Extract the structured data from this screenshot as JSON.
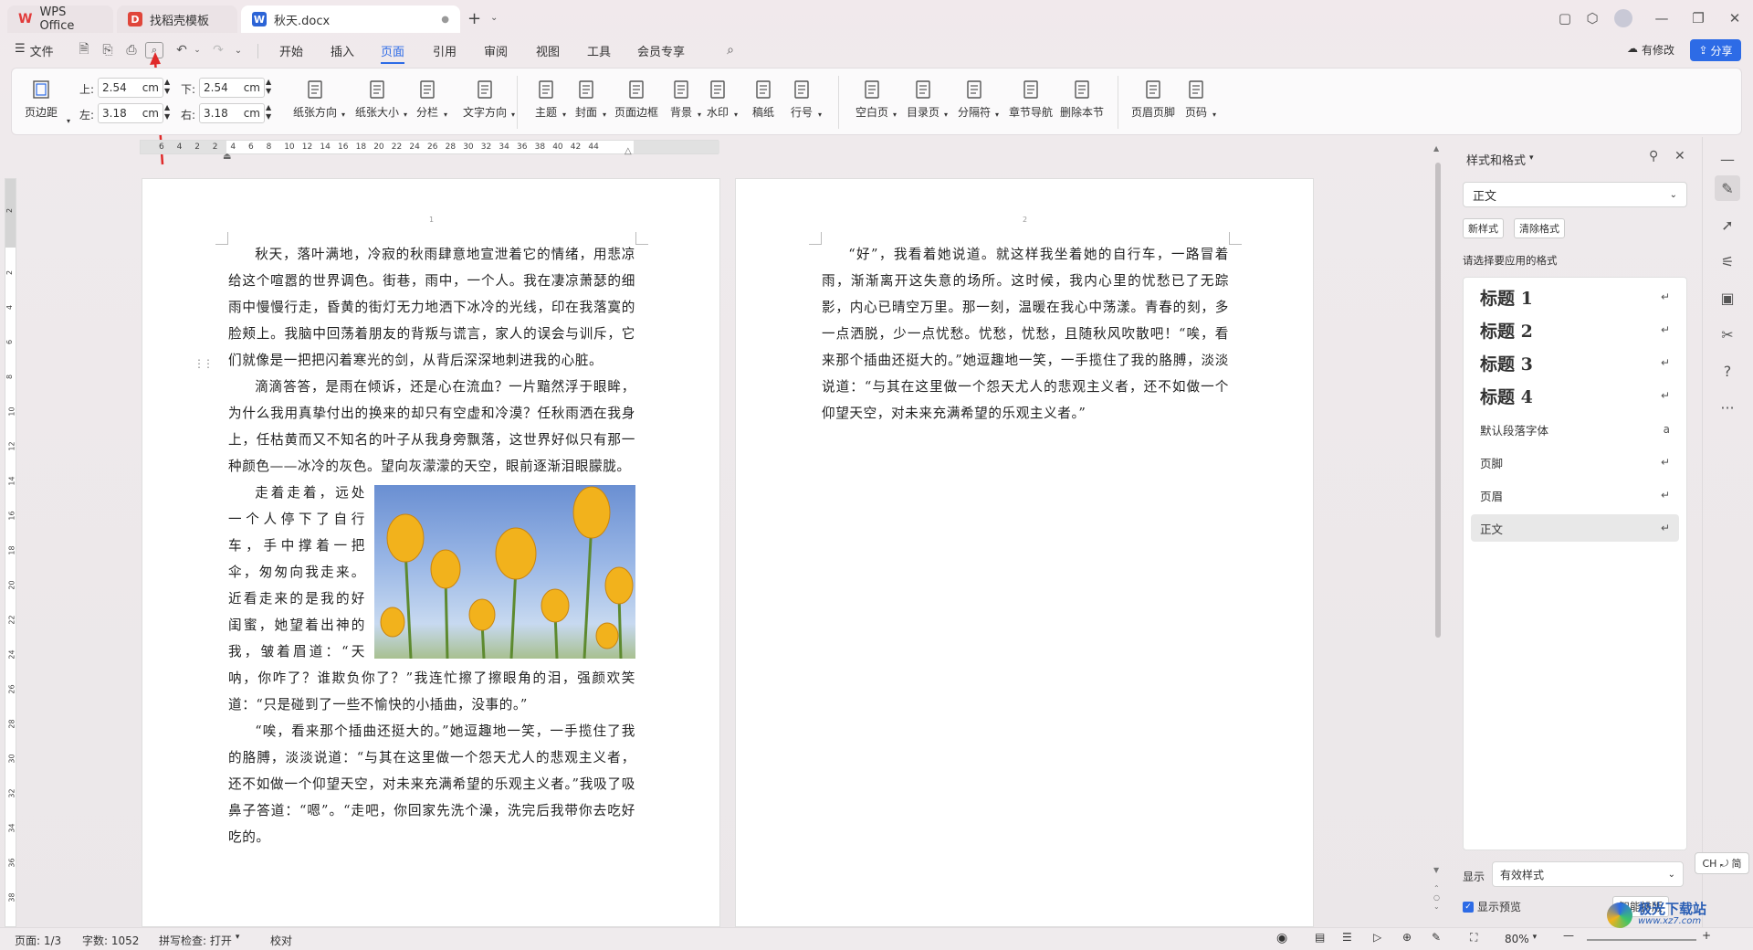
{
  "tabs": [
    {
      "label": "WPS Office",
      "icon": "wps-logo-icon"
    },
    {
      "label": "找稻壳模板",
      "icon": "docer-icon"
    },
    {
      "label": "秋天.docx",
      "icon": "word-doc-icon"
    }
  ],
  "menu": {
    "file": "文件",
    "items": [
      "开始",
      "插入",
      "页面",
      "引用",
      "审阅",
      "视图",
      "工具",
      "会员专享"
    ],
    "active": "页面",
    "modified": "有修改",
    "share": "分享"
  },
  "ribbon": {
    "margins": {
      "label": "页边距",
      "top_label": "上:",
      "top": "2.54",
      "bottom_label": "下:",
      "bottom": "2.54",
      "left_label": "左:",
      "left": "3.18",
      "right_label": "右:",
      "right": "3.18",
      "unit": "cm"
    },
    "buttons": [
      "纸张方向",
      "纸张大小",
      "分栏",
      "文字方向",
      "主题",
      "封面",
      "页面边框",
      "背景",
      "水印",
      "稿纸",
      "行号",
      "空白页",
      "目录页",
      "分隔符",
      "章节导航",
      "删除本节",
      "页眉页脚",
      "页码"
    ]
  },
  "ruler": {
    "ticks": [
      "6",
      "4",
      "2",
      "2",
      "4",
      "6",
      "8",
      "10",
      "12",
      "14",
      "16",
      "18",
      "20",
      "22",
      "24",
      "26",
      "28",
      "30",
      "32",
      "34",
      "36",
      "38",
      "40",
      "42",
      "44"
    ]
  },
  "vruler": {
    "ticks": [
      "2",
      "2",
      "4",
      "6",
      "8",
      "10",
      "12",
      "14",
      "16",
      "18",
      "20",
      "22",
      "24",
      "26",
      "28",
      "30",
      "32",
      "34",
      "36",
      "38"
    ]
  },
  "page1": {
    "number": "1",
    "p1": "秋天，落叶满地，冷寂的秋雨肆意地宣泄着它的情绪，用悲凉给这个喧嚣的世界调色。街巷，雨中，一个人。我在凄凉萧瑟的细雨中慢慢行走，昏黄的街灯无力地洒下冰冷的光线，印在我落寞的脸颊上。我脑中回荡着朋友的背叛与谎言，家人的误会与训斥，它们就像是一把把闪着寒光的剑，从背后深深地刺进我的心脏。",
    "p2": "滴滴答答，是雨在倾诉，还是心在流血？一片黯然浮于眼眸，为什么我用真挚付出的换来的却只有空虚和冷漠？任秋雨洒在我身上，任枯黄而又不知名的叶子从我身旁飘落，这世界好似只有那一种颜色——冰冷的灰色。望向灰濛濛的天空，眼前逐渐泪眼朦胧。",
    "p3a": "走着走着，远处一个人停下了自行车，手中撑着一把伞，匆匆向我走来。近看走来的是我的好闺蜜，她望着出神的我，皱着眉道：“天呐，你咋了？谁欺负你了？”我连忙擦了擦眼角的泪，强颜欢笑道：“只是碰到了一些不愉快的小插曲，没事的。”",
    "p4": "“唉，看来那个插曲还挺大的。”她逗趣地一笑，一手揽住了我的胳膊，淡淡说道：“与其在这里做一个怨天尤人的悲观主义者，还不如做一个仰望天空，对未来充满希望的乐观主义者。”我吸了吸鼻子答道：“嗯”。“走吧，你回家先洗个澡，洗完后我带你去吃好吃的。"
  },
  "page2": {
    "number": "2",
    "p1": "“好”，我看着她说道。就这样我坐着她的自行车，一路冒着雨，渐渐离开这失意的场所。这时候，我内心里的忧愁已了无踪影，内心已晴空万里。那一刻，温暖在我心中荡漾。青春的刻，多一点洒脱，少一点忧愁。忧愁，忧愁，且随秋风吹散吧！“唉，看来那个插曲还挺大的。”她逗趣地一笑，一手揽住了我的胳膊，淡淡说道：“与其在这里做一个怨天尤人的悲观主义者，还不如做一个仰望天空，对未来充满希望的乐观主义者。”"
  },
  "panel": {
    "title": "样式和格式",
    "current": "正文",
    "new_style": "新样式",
    "clear_format": "清除格式",
    "choose": "请选择要应用的格式",
    "styles": [
      "标题 1",
      "标题 2",
      "标题 3",
      "标题 4",
      "默认段落字体",
      "页脚",
      "页眉",
      "正文"
    ],
    "show_label": "显示",
    "show_value": "有效样式",
    "preview": "显示预览",
    "smart": "智能排版"
  },
  "ime": "CH ⤾ 简",
  "status": {
    "page": "页面: 1/3",
    "words": "字数: 1052",
    "spell": "拼写检查: 打开",
    "proof": "校对",
    "zoom": "80%"
  },
  "watermark": "极光下载站",
  "watermark_url": "www.xz7.com"
}
